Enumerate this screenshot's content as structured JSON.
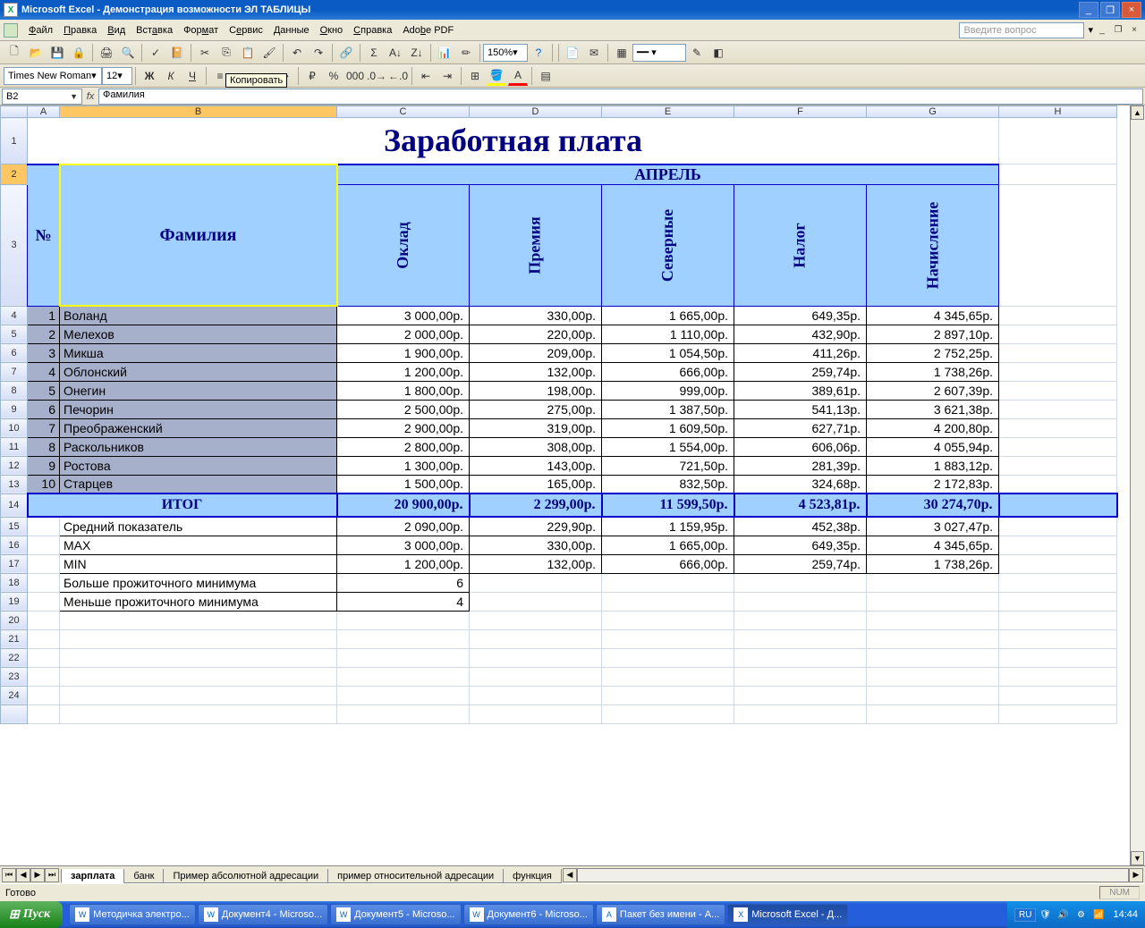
{
  "window": {
    "title": "Microsoft Excel - Демонстрация возможности ЭЛ ТАБЛИЦЫ"
  },
  "menu": {
    "file": "Файл",
    "edit": "Правка",
    "view": "Вид",
    "insert": "Вставка",
    "format": "Формат",
    "tools": "Сервис",
    "data": "Данные",
    "window": "Окно",
    "help": "Справка",
    "adobe": "Adobe PDF",
    "question_placeholder": "Введите вопрос"
  },
  "toolbar2": {
    "font": "Times New Roman",
    "size": "12",
    "zoom": "150%"
  },
  "tooltip": "Копировать",
  "namebox": "B2",
  "formula": "Фамилия",
  "columns": [
    "A",
    "B",
    "C",
    "D",
    "E",
    "F",
    "G",
    "H"
  ],
  "sheet": {
    "title": "Заработная плата",
    "month": "АПРЕЛЬ",
    "hdr_num": "№",
    "hdr_fam": "Фамилия",
    "hdr_cols": [
      "Оклад",
      "Премия",
      "Северные",
      "Налог",
      "Начисление"
    ],
    "rows": [
      {
        "n": "1",
        "name": "Воланд",
        "v": [
          "3 000,00р.",
          "330,00р.",
          "1 665,00р.",
          "649,35р.",
          "4 345,65р."
        ]
      },
      {
        "n": "2",
        "name": "Мелехов",
        "v": [
          "2 000,00р.",
          "220,00р.",
          "1 110,00р.",
          "432,90р.",
          "2 897,10р."
        ]
      },
      {
        "n": "3",
        "name": "Микша",
        "v": [
          "1 900,00р.",
          "209,00р.",
          "1 054,50р.",
          "411,26р.",
          "2 752,25р."
        ]
      },
      {
        "n": "4",
        "name": "Облонский",
        "v": [
          "1 200,00р.",
          "132,00р.",
          "666,00р.",
          "259,74р.",
          "1 738,26р."
        ]
      },
      {
        "n": "5",
        "name": "Онегин",
        "v": [
          "1 800,00р.",
          "198,00р.",
          "999,00р.",
          "389,61р.",
          "2 607,39р."
        ]
      },
      {
        "n": "6",
        "name": "Печорин",
        "v": [
          "2 500,00р.",
          "275,00р.",
          "1 387,50р.",
          "541,13р.",
          "3 621,38р."
        ]
      },
      {
        "n": "7",
        "name": "Преображенский",
        "v": [
          "2 900,00р.",
          "319,00р.",
          "1 609,50р.",
          "627,71р.",
          "4 200,80р."
        ]
      },
      {
        "n": "8",
        "name": "Раскольников",
        "v": [
          "2 800,00р.",
          "308,00р.",
          "1 554,00р.",
          "606,06р.",
          "4 055,94р."
        ]
      },
      {
        "n": "9",
        "name": "Ростова",
        "v": [
          "1 300,00р.",
          "143,00р.",
          "721,50р.",
          "281,39р.",
          "1 883,12р."
        ]
      },
      {
        "n": "10",
        "name": "Старцев",
        "v": [
          "1 500,00р.",
          "165,00р.",
          "832,50р.",
          "324,68р.",
          "2 172,83р."
        ]
      }
    ],
    "total_label": "ИТОГ",
    "total": [
      "20 900,00р.",
      "2 299,00р.",
      "11 599,50р.",
      "4 523,81р.",
      "30 274,70р."
    ],
    "stats": [
      {
        "label": "Средний показатель",
        "v": [
          "2 090,00р.",
          "229,90р.",
          "1 159,95р.",
          "452,38р.",
          "3 027,47р."
        ]
      },
      {
        "label": "MAX",
        "v": [
          "3 000,00р.",
          "330,00р.",
          "1 665,00р.",
          "649,35р.",
          "4 345,65р."
        ]
      },
      {
        "label": "MIN",
        "v": [
          "1 200,00р.",
          "132,00р.",
          "666,00р.",
          "259,74р.",
          "1 738,26р."
        ]
      }
    ],
    "extra": [
      {
        "label": "Больше прожиточного минимума",
        "v": "6"
      },
      {
        "label": "Меньше прожиточного минимума",
        "v": "4"
      }
    ]
  },
  "tabs": [
    "зарплата",
    "банк",
    "Пример абсолютной адресации",
    "пример относительной адресации",
    "функция"
  ],
  "status": {
    "ready": "Готово",
    "num": "NUM"
  },
  "taskbar": {
    "start": "Пуск",
    "items": [
      "Методичка электро...",
      "Документ4 - Microso...",
      "Документ5 - Microso...",
      "Документ6 - Microso...",
      "Пакет без имени - A...",
      "Microsoft Excel - Д..."
    ],
    "lang": "RU",
    "time": "14:44"
  }
}
